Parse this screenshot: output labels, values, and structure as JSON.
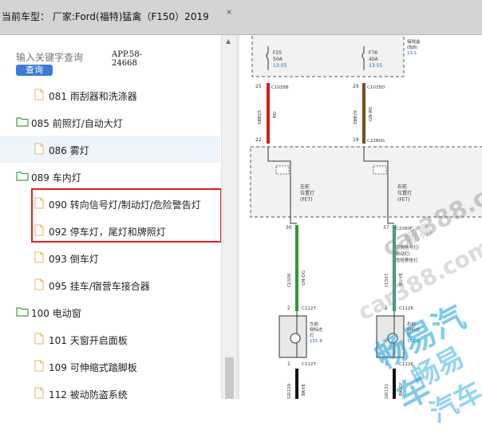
{
  "header": {
    "title": "当前车型： 厂家:Ford(福特)猛禽（F150）2019",
    "close_glyph": "×"
  },
  "search": {
    "placeholder": "输入关键字查询",
    "button_label": "查询",
    "app_id_line1": "APP.58-",
    "app_id_line2": "24668"
  },
  "tree": {
    "items": [
      {
        "label": "081 雨刮器和洗涤器",
        "type": "file"
      },
      {
        "label": "085 前照灯/自动大灯",
        "type": "folder"
      },
      {
        "label": "086 雾灯",
        "type": "file"
      },
      {
        "label": "089 车内灯",
        "type": "folder"
      },
      {
        "label": "090 转向信号灯/制动灯/危险警告灯",
        "type": "file"
      },
      {
        "label": "092 停车灯，尾灯和牌照灯",
        "type": "file"
      },
      {
        "label": "093 倒车灯",
        "type": "file"
      },
      {
        "label": "095 挂车/宿营车接合器",
        "type": "file"
      },
      {
        "label": "100 电动窗",
        "type": "folder"
      },
      {
        "label": "101 天窗开启面板",
        "type": "file"
      },
      {
        "label": "109 可伸缩式踏脚板",
        "type": "file"
      },
      {
        "label": "112 被动防盗系统",
        "type": "file"
      }
    ]
  },
  "diagram": {
    "bjb_label_1": "接线盒",
    "bjb_label_2": "(BJB)",
    "bjb_ref": "11-1",
    "fuse_left": {
      "id": "F25",
      "rating": "50A",
      "ref": "13-55"
    },
    "fuse_right": {
      "id": "F76",
      "rating": "40A",
      "ref": "13-55"
    },
    "pin_25": "25",
    "pin_29": "29",
    "conn_c1035b": "C1035B",
    "conn_c1035d": "C1035D",
    "wire_sbb25": "SBB25",
    "wire_sbb76": "SBB76",
    "color_rd": "RD",
    "color_gnrd": "GN-RD",
    "pin_22": "22",
    "pin_19": "19",
    "conn_c2280g": "C2280G",
    "fet_left_1": "左前",
    "fet_left_2": "位置灯",
    "fet_left_3": "(FET)",
    "fet_right_1": "右前",
    "fet_right_2": "位置灯",
    "fet_right_3": "(FET)",
    "pin_30": "30",
    "pin_37": "37",
    "conn_c2280f": "C2280F",
    "right_note_1": "转向信号灯/",
    "right_note_2": "制动灯/",
    "right_note_3": "危险警告灯",
    "wire_cls06": "CLS06",
    "wire_cls07": "CLS07",
    "color_gnog": "GN-OG",
    "color_blye": "BU-YE",
    "pin_2a": "2",
    "pin_2b": "2",
    "conn_c1127": "C1127",
    "conn_c1126": "C1126",
    "lamp_left_1": "左前",
    "lamp_left_2": "侧标志",
    "lamp_left_3": "灯",
    "lamp_left_ref": "151-6",
    "lamp_right_1": "右前",
    "lamp_right_2": "侧标志",
    "lamp_right_3": "灯",
    "lamp_right_ref": "151-6",
    "pin_1a": "1",
    "pin_1b": "1",
    "conn_c1127b": "C1127",
    "conn_c1126b": "C1126",
    "wire_gd129": "GD129",
    "wire_gd131": "GD131",
    "color_bkye": "BK-YE",
    "color_bkgy": "BK-GY"
  },
  "watermarks": {
    "wm1": "car388.com",
    "wm2": "畅易汽车",
    "wm3": "car388.com",
    "wm4": "畅易汽车",
    "wm5": "畅易"
  },
  "colors": {
    "highlight_red": "#e02020",
    "wire_red": "#d21f1f",
    "wire_green": "#2e9b2e",
    "wire_green_dark": "#1d7a1d",
    "watermark_blue": "#1aa0d8"
  }
}
